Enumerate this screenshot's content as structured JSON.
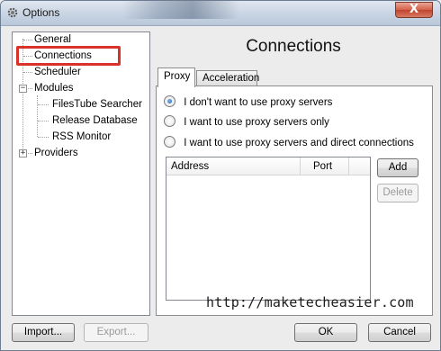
{
  "window": {
    "title": "Options",
    "close_label": "X"
  },
  "tree": {
    "items": [
      {
        "label": "General"
      },
      {
        "label": "Connections"
      },
      {
        "label": "Scheduler"
      },
      {
        "label": "Modules",
        "expander": "−"
      },
      {
        "label": "FilesTube Searcher"
      },
      {
        "label": "Release Database"
      },
      {
        "label": "RSS Monitor"
      },
      {
        "label": "Providers",
        "expander": "+"
      }
    ],
    "highlight_color": "#d9322a"
  },
  "content": {
    "title": "Connections",
    "tabs": [
      {
        "label": "Proxy"
      },
      {
        "label": "Acceleration"
      }
    ],
    "proxy": {
      "options": [
        {
          "label": "I don't want to use proxy servers",
          "checked": true
        },
        {
          "label": "I want to use proxy servers only",
          "checked": false
        },
        {
          "label": "I want to use proxy servers and direct connections",
          "checked": false
        }
      ],
      "columns": [
        "Address",
        "Port"
      ],
      "add_label": "Add",
      "delete_label": "Delete"
    }
  },
  "footer": {
    "import_label": "Import...",
    "export_label": "Export...",
    "ok_label": "OK",
    "cancel_label": "Cancel"
  },
  "watermark": "http://maketecheasier.com"
}
